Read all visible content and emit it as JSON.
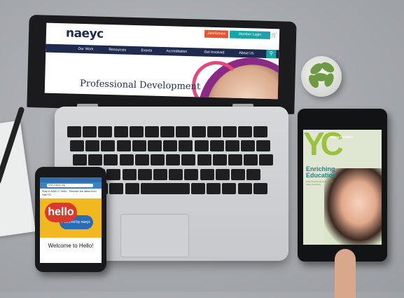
{
  "laptop": {
    "logo": "naeyc",
    "join_btn": "Join/Renew",
    "login_btn": "Member Login",
    "nav": [
      "Our Work",
      "Resources",
      "Events",
      "Accreditation",
      "Get Involved",
      "About Us"
    ],
    "hero_title": "Professional Development"
  },
  "phone": {
    "url": "hello.naeyc.org",
    "intro_text": "Stay in NAEYC Hello · Receive the latest from NAEYC",
    "hello_label": "hello",
    "hello_sub": "Powered by naeyc",
    "welcome": "Welcome to Hello!"
  },
  "tablet": {
    "masthead": "YC",
    "masthead_sub": "Young Children",
    "headline": "Enriching Education",
    "kicker": "What Preschoolers Teach Us About Teaching"
  },
  "colors": {
    "naeyc_navy": "#1e2b4f",
    "teal": "#1ba4a8",
    "orange": "#e8542d",
    "purple": "#8b2a86",
    "hello_yellow": "#f2b81f",
    "hello_red": "#d93a2b",
    "yc_green": "#9cc13c"
  }
}
